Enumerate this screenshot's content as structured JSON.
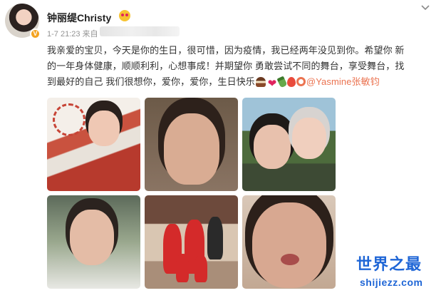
{
  "user": {
    "name": "钟丽缇Christy",
    "verified_badge": "V"
  },
  "post": {
    "date": "1-7 21:23",
    "source_prefix": "来自",
    "text_line1": "我亲爱的宝贝，今天是你的生日，很可惜，因为疫情，我已经两年没见到你。希望你 新",
    "text_line2": "的一年身体健康，顺顺利利，心想事成！并期望你 勇敢尝试不同的舞台，享受舞台，找",
    "text_line3_start": "到最好的自己 我们很想你，爱你，爱你，生日快乐",
    "mention": "@Yasmine张敏钧",
    "emojis": [
      "cake-emoji",
      "heart-emoji",
      "bottle-emoji",
      "balloon-emoji"
    ]
  },
  "photos": [
    {
      "id": "photo-1"
    },
    {
      "id": "photo-2"
    },
    {
      "id": "photo-3"
    },
    {
      "id": "photo-4"
    },
    {
      "id": "photo-5"
    },
    {
      "id": "photo-6"
    }
  ],
  "watermark": {
    "title": "世界之最",
    "site": "shijiezz.com"
  },
  "colors": {
    "mention": "#eb7350",
    "watermark": "#1f66d6",
    "verified": "#f4a321"
  },
  "icons": {
    "menu": "chevron-down-icon"
  }
}
